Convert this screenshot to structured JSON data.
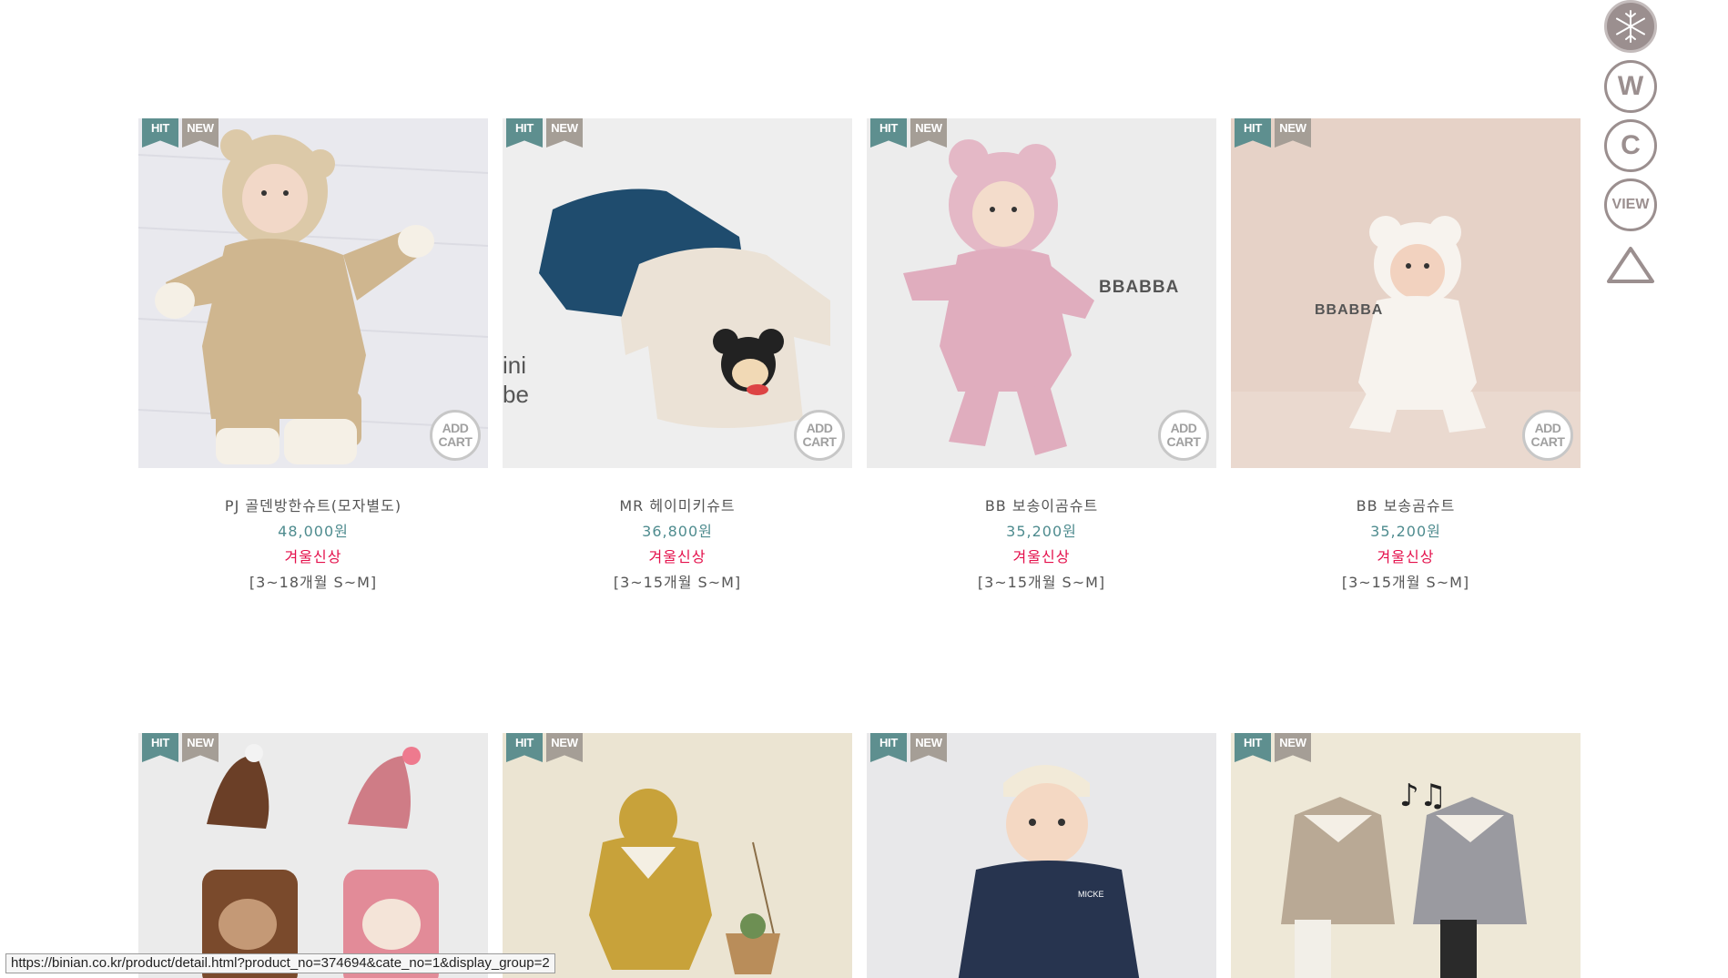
{
  "products": [
    {
      "name": "PJ 골덴방한슈트(모자별도)",
      "price": "48,000원",
      "tag": "겨울신상",
      "size": "[3~18개월 S~M]",
      "hit": "HIT",
      "new": "NEW",
      "add_cart": "ADD CART"
    },
    {
      "name": "MR 헤이미키슈트",
      "price": "36,800원",
      "tag": "겨울신상",
      "size": "[3~15개월 S~M]",
      "hit": "HIT",
      "new": "NEW",
      "add_cart": "ADD CART"
    },
    {
      "name": "BB 보송이곰슈트",
      "price": "35,200원",
      "tag": "겨울신상",
      "size": "[3~15개월 S~M]",
      "hit": "HIT",
      "new": "NEW",
      "add_cart": "ADD CART",
      "brand": "BBABBA"
    },
    {
      "name": "BB 보송곰슈트",
      "price": "35,200원",
      "tag": "겨울신상",
      "size": "[3~15개월 S~M]",
      "hit": "HIT",
      "new": "NEW",
      "add_cart": "ADD CART",
      "brand": "BBABBA"
    }
  ],
  "products_row2": [
    {
      "hit": "HIT",
      "new": "NEW"
    },
    {
      "hit": "HIT",
      "new": "NEW"
    },
    {
      "hit": "HIT",
      "new": "NEW"
    },
    {
      "hit": "HIT",
      "new": "NEW"
    }
  ],
  "side_nav": {
    "snow": "snowflake-icon",
    "w": "W",
    "c": "C",
    "view": "VIEW",
    "top": "up-triangle-icon"
  },
  "status_bar_url": "https://binian.co.kr/product/detail.html?product_no=374694&cate_no=1&display_group=2",
  "colors": {
    "price": "#4f8c8f",
    "tag": "#e4114c",
    "hit_ribbon": "#5e8f8f",
    "new_ribbon": "#a59e96",
    "side_nav": "#9b8f8f"
  }
}
